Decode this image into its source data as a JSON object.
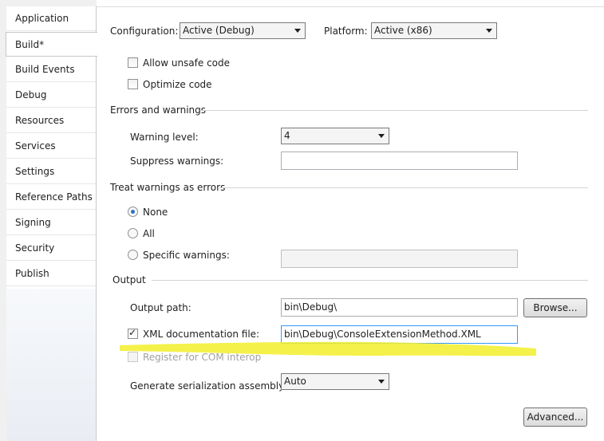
{
  "sidebar": {
    "items": [
      {
        "label": "Application"
      },
      {
        "label": "Build*"
      },
      {
        "label": "Build Events"
      },
      {
        "label": "Debug"
      },
      {
        "label": "Resources"
      },
      {
        "label": "Services"
      },
      {
        "label": "Settings"
      },
      {
        "label": "Reference Paths"
      },
      {
        "label": "Signing"
      },
      {
        "label": "Security"
      },
      {
        "label": "Publish"
      }
    ],
    "active_index": 1
  },
  "header": {
    "configuration_label": "Configuration:",
    "configuration_value": "Active (Debug)",
    "platform_label": "Platform:",
    "platform_value": "Active (x86)"
  },
  "general": {
    "allow_unsafe_label": "Allow unsafe code",
    "optimize_label": "Optimize code"
  },
  "errors": {
    "section_title": "Errors and warnings",
    "warning_level_label": "Warning level:",
    "warning_level_value": "4",
    "suppress_label": "Suppress warnings:",
    "suppress_value": ""
  },
  "treat": {
    "section_title": "Treat warnings as errors",
    "none_label": "None",
    "all_label": "All",
    "specific_label": "Specific warnings:",
    "specific_value": ""
  },
  "output": {
    "section_title": "Output",
    "output_path_label": "Output path:",
    "output_path_value": "bin\\Debug\\",
    "browse_label": "Browse...",
    "xml_doc_label": "XML documentation file:",
    "xml_doc_value": "bin\\Debug\\ConsoleExtensionMethod.XML",
    "register_com_label": "Register for COM interop",
    "serialization_label": "Generate serialization assembly:",
    "serialization_value": "Auto",
    "advanced_label": "Advanced..."
  },
  "annotation": {
    "highlight_color": "#f2ef2a"
  }
}
